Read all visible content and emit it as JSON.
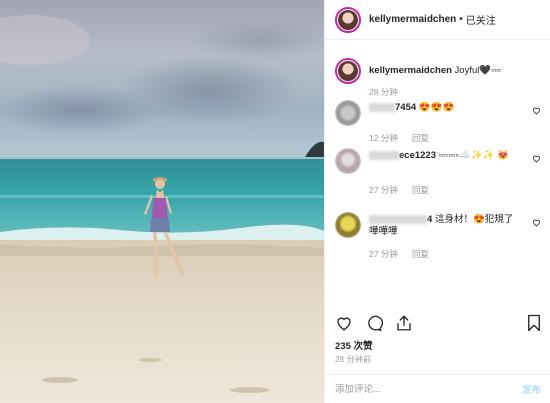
{
  "photo": {
    "alt": ""
  },
  "header": {
    "username": "kellymermaidchen",
    "separator": "•",
    "follow_label": "已关注"
  },
  "caption": {
    "username": "kellymermaidchen",
    "text": "Joyful🖤▫▫▫",
    "time": "28 分钟"
  },
  "comments": [
    {
      "username_suffix": "7454",
      "text": "😍😍😍",
      "time": "12 分钟",
      "reply_label": "回复"
    },
    {
      "username_suffix": "ece1223",
      "text": "▫▫▫▫▫▫☁️✨✨ 😻",
      "time": "27 分钟",
      "reply_label": "回复"
    },
    {
      "username_suffix": "4",
      "text": "這身材！😍犯規了 嘩嘩嘩",
      "time": "27 分钟",
      "reply_label": "回复"
    }
  ],
  "actions": {
    "likes": "235 次赞",
    "date": "28 分钟前"
  },
  "add_comment": {
    "placeholder": "添加评论...",
    "post_label": "发布"
  },
  "colors": {
    "ring": "#c32aa3",
    "post_disabled": "#b2dffc",
    "muted": "#999999"
  },
  "icons": [
    "heart-icon",
    "comment-icon",
    "share-icon",
    "bookmark-icon",
    "small-heart-icon"
  ]
}
